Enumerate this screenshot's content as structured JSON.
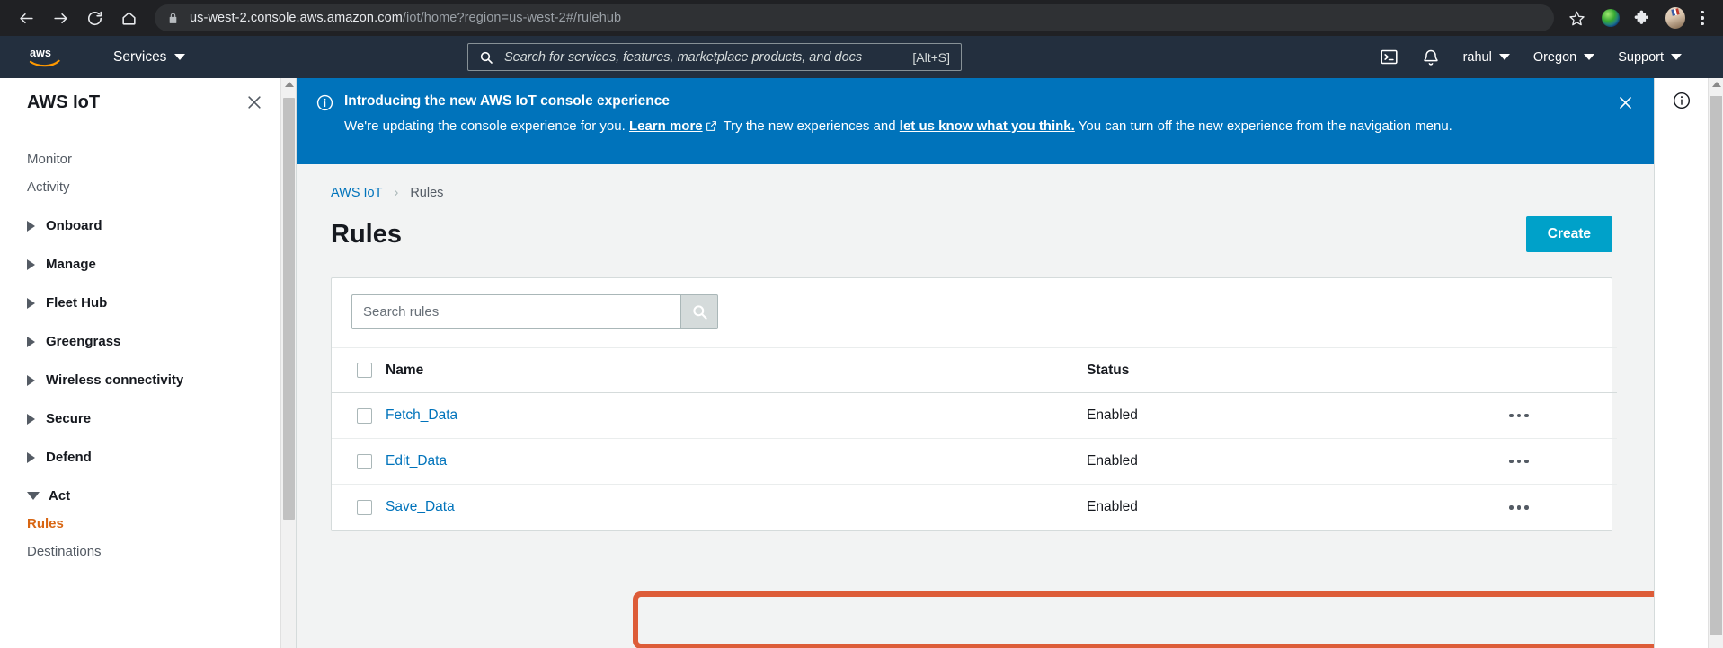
{
  "browser": {
    "url_secure": "us-west-2.console.aws.amazon.com",
    "url_path": "/iot/home?region=us-west-2#/rulehub",
    "back_icon": "back-arrow-icon",
    "forward_icon": "forward-arrow-icon",
    "reload_icon": "reload-icon",
    "home_icon": "home-icon",
    "lock_icon": "lock-icon",
    "star_icon": "bookmark-star-icon",
    "menu_icon": "browser-menu-icon"
  },
  "aws_nav": {
    "logo": "aws-logo",
    "services_label": "Services",
    "search_placeholder": "Search for services, features, marketplace products, and docs",
    "search_shortcut": "[Alt+S]",
    "cloudshell_icon": "cloudshell-icon",
    "notifications_icon": "bell-icon",
    "account_label": "rahul",
    "region_label": "Oregon",
    "support_label": "Support"
  },
  "sidebar": {
    "title": "AWS IoT",
    "close_icon": "close-icon",
    "items": [
      {
        "label": "Monitor",
        "type": "plain"
      },
      {
        "label": "Activity",
        "type": "plain"
      },
      {
        "label": "Onboard",
        "type": "group",
        "expanded": false
      },
      {
        "label": "Manage",
        "type": "group",
        "expanded": false
      },
      {
        "label": "Fleet Hub",
        "type": "group",
        "expanded": false
      },
      {
        "label": "Greengrass",
        "type": "group",
        "expanded": false
      },
      {
        "label": "Wireless connectivity",
        "type": "group",
        "expanded": false
      },
      {
        "label": "Secure",
        "type": "group",
        "expanded": false
      },
      {
        "label": "Defend",
        "type": "group",
        "expanded": false
      },
      {
        "label": "Act",
        "type": "group",
        "expanded": true
      },
      {
        "label": "Rules",
        "type": "sub",
        "active": true
      },
      {
        "label": "Destinations",
        "type": "sub",
        "active": false
      }
    ]
  },
  "flash": {
    "info_icon": "info-circle-icon",
    "title": "Introducing the new AWS IoT console experience",
    "text_1": "We're updating the console experience for you.",
    "link_1": "Learn more",
    "external_icon": "external-link-icon",
    "text_2": "Try the new experiences and",
    "link_2": "let us know what you think.",
    "text_3": "You can turn off the new experience from the navigation menu.",
    "close_icon": "close-icon"
  },
  "breadcrumb": {
    "root": "AWS IoT",
    "separator": "›",
    "current": "Rules"
  },
  "page": {
    "title": "Rules",
    "create_label": "Create"
  },
  "search": {
    "placeholder": "Search rules",
    "icon": "search-icon"
  },
  "table": {
    "headers": {
      "name": "Name",
      "status": "Status"
    },
    "rows": [
      {
        "name": "Fetch_Data",
        "status": "Enabled",
        "highlighted": false
      },
      {
        "name": "Edit_Data",
        "status": "Enabled",
        "highlighted": false
      },
      {
        "name": "Save_Data",
        "status": "Enabled",
        "highlighted": true
      }
    ],
    "actions_icon": "more-actions-icon"
  },
  "info_rail": {
    "icon": "info-circle-icon"
  },
  "colors": {
    "aws_nav": "#232f3e",
    "flash_blue": "#0073bb",
    "create_button": "#00a1c9",
    "link": "#0073bb",
    "active_nav": "#d86613",
    "highlight_box": "#dd5c38"
  }
}
